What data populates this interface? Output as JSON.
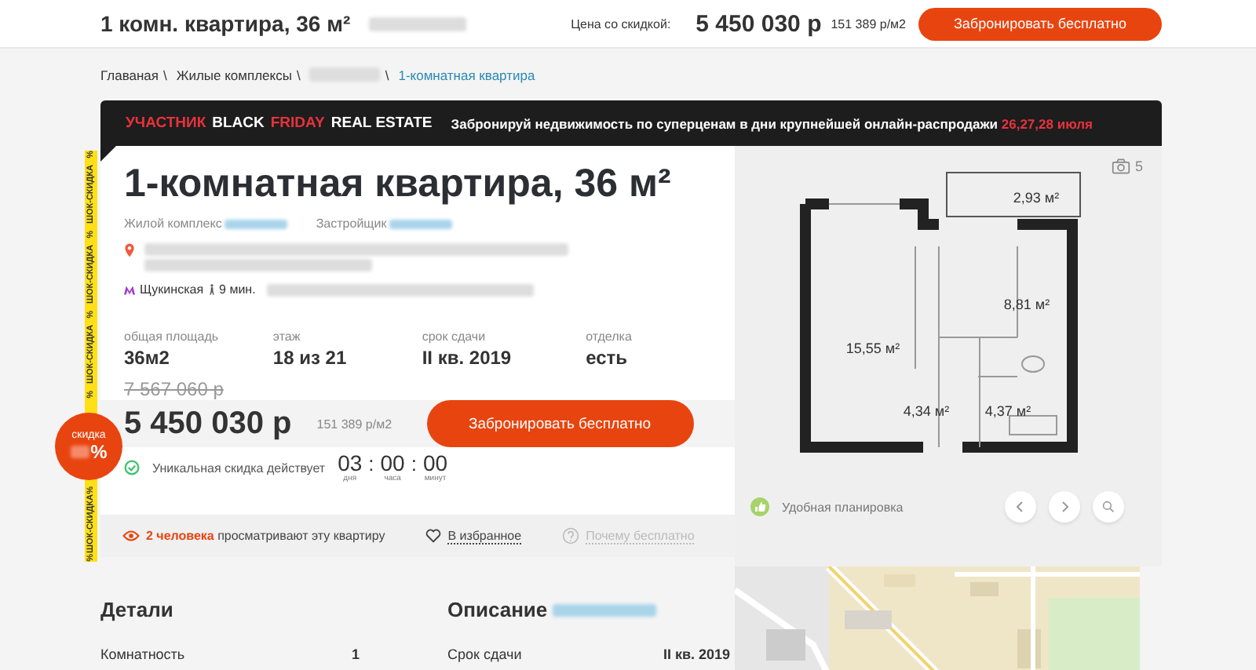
{
  "header": {
    "title": "1 комн. квартира, 36 м²",
    "price_label": "Цена со скидкой:",
    "price": "5 450 030 р",
    "per_m2": "151 389 р/м2",
    "button": "Забронировать бесплатно"
  },
  "breadcrumbs": [
    {
      "kind": "link",
      "label": "Главаная",
      "sep": "\\"
    },
    {
      "kind": "link",
      "label": "Жилые комплексы",
      "sep": "\\"
    },
    {
      "kind": "blurred",
      "sep": "\\"
    },
    {
      "kind": "current",
      "label": "1-комнатная квартира"
    }
  ],
  "banner": {
    "tags": [
      {
        "text": "УЧАСТНИК",
        "color": "#e8323c"
      },
      {
        "text": "BLACK",
        "color": "#ffffff"
      },
      {
        "text": "FRIDAY",
        "color": "#e8323c"
      },
      {
        "text": "REAL ESTATE",
        "color": "#ffffff"
      }
    ],
    "message": "Забронируй недвижимость по суперценам в дни крупнейшей онлайн-распродажи",
    "dates": "26,27,28 июля"
  },
  "ribbon": {
    "top": [
      "%",
      "ШОК-СКИДКА",
      "%",
      "ШОК-СКИДКА",
      "%",
      "ШОК-СКИДКА",
      "%"
    ],
    "bottom": [
      "%",
      "ШОК-СКИДКА",
      "%"
    ]
  },
  "card": {
    "title": "1-комнатная квартира, 36 м²",
    "complex_label": "Жилой комплекс",
    "developer_label": "Застройщик",
    "metro": "Щукинская",
    "walk": "9 мин.",
    "specs": [
      {
        "label": "общая площадь",
        "value": "36м2"
      },
      {
        "label": "этаж",
        "value": "18 из 21"
      },
      {
        "label": "срок сдачи",
        "value": "II кв. 2019"
      },
      {
        "label": "отделка",
        "value": "есть"
      }
    ],
    "old_price": "7 567 060 р",
    "price": "5 450 030 р",
    "per_m2": "151 389 р/м2",
    "button": "Забронировать бесплатно",
    "discount": {
      "label": "скидка",
      "percent": "%"
    },
    "timer_label": "Уникальная скидка действует",
    "timer_sep": ":",
    "timer": [
      {
        "value": "03",
        "unit": "дня"
      },
      {
        "value": "00",
        "unit": "часа"
      },
      {
        "value": "00",
        "unit": "минут"
      }
    ]
  },
  "strip": {
    "viewers": "2 человека",
    "viewers_text": "просматривают эту квартиру",
    "favorite": "В избранное",
    "why": "Почему бесплатно"
  },
  "gallery": {
    "photo_count": "5",
    "feature": "Удобная планировка",
    "rooms": [
      "2,93 м²",
      "8,81 м²",
      "15,55 м²",
      "4,34 м²",
      "4,37 м²"
    ]
  },
  "details": {
    "heading": "Детали",
    "rows": [
      {
        "label": "Комнатность",
        "value": "1"
      }
    ]
  },
  "description": {
    "heading": "Описание",
    "rows": [
      {
        "label": "Срок сдачи",
        "value": "II кв. 2019"
      }
    ]
  }
}
